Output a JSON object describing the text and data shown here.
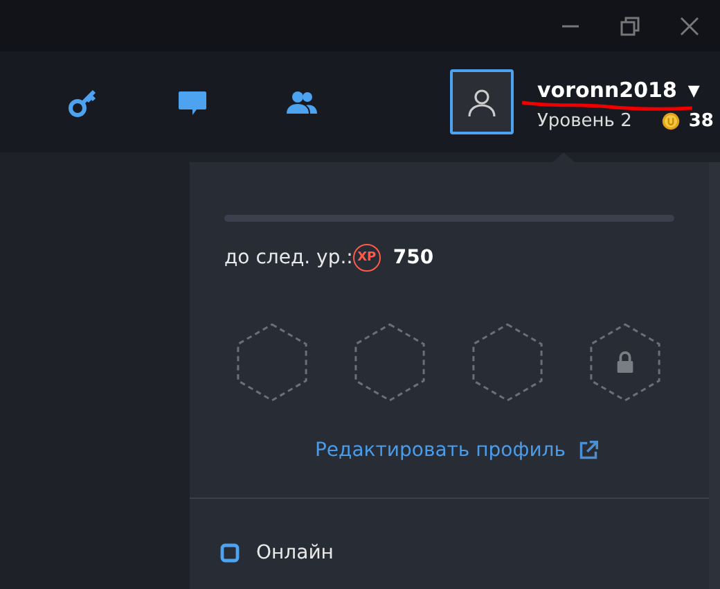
{
  "window_controls": [
    {
      "kind": "minimize"
    },
    {
      "kind": "maximize"
    },
    {
      "kind": "close"
    }
  ],
  "nav_icons": [
    {
      "kind": "key"
    },
    {
      "kind": "chat"
    },
    {
      "kind": "friends"
    }
  ],
  "user": {
    "name": "voronn2018",
    "caret": "▼",
    "level_label": "Уровень 2",
    "coins": "38"
  },
  "profile_panel": {
    "progress": {
      "level": 0
    },
    "next_level_label": "до след. ур.:",
    "xp_badge": "XP",
    "xp_needed": "750",
    "badges": [
      {
        "locked": false
      },
      {
        "locked": false
      },
      {
        "locked": false
      },
      {
        "locked": true
      }
    ],
    "edit_link": "Редактировать профиль",
    "status": "Онлайн"
  }
}
